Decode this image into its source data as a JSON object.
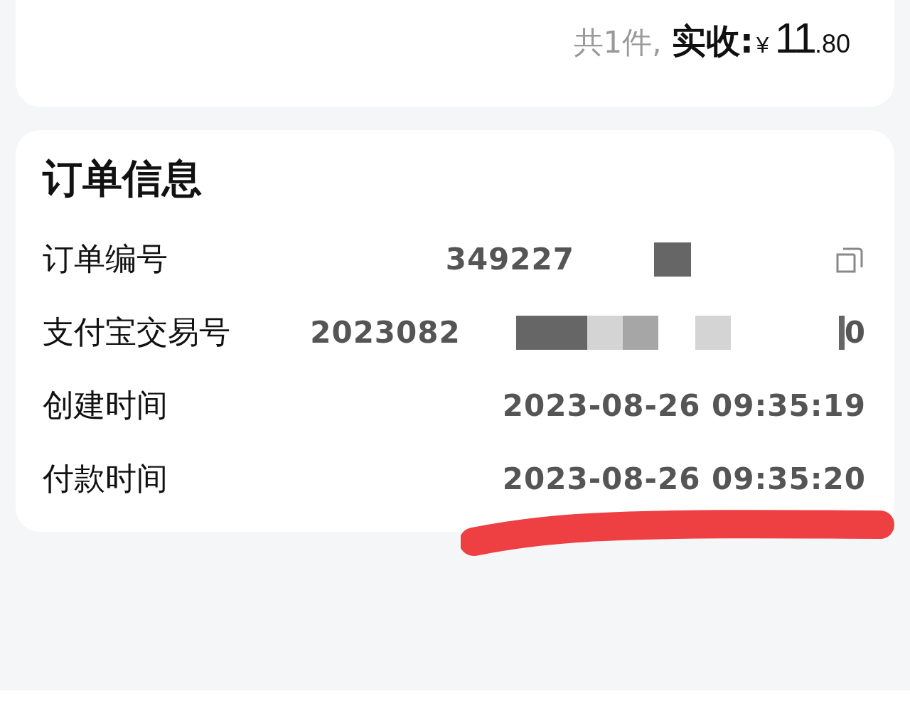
{
  "summary": {
    "count_text": "共1件,",
    "label": "实收:",
    "currency": "¥",
    "amount_integer": "11",
    "amount_decimal": ".80"
  },
  "order_info": {
    "title": "订单信息",
    "rows": [
      {
        "kind": "copyable",
        "label": "订单编号",
        "value": "349227"
      },
      {
        "kind": "redacted",
        "label": "支付宝交易号",
        "value": "2023082",
        "value_end": "0"
      },
      {
        "kind": "plain",
        "label": "创建时间",
        "value": "2023-08-26 09:35:19"
      },
      {
        "kind": "plain",
        "label": "付款时间",
        "value": "2023-08-26 09:35:20"
      }
    ]
  }
}
